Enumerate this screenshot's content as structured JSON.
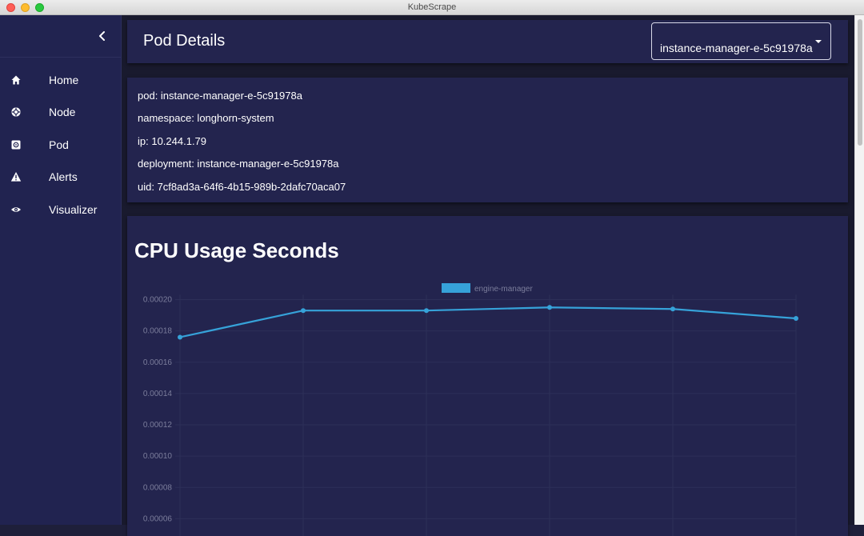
{
  "window": {
    "title": "KubeScrape"
  },
  "sidebar": {
    "items": [
      {
        "label": "Home",
        "icon": "home-icon"
      },
      {
        "label": "Node",
        "icon": "node-icon"
      },
      {
        "label": "Pod",
        "icon": "pod-icon"
      },
      {
        "label": "Alerts",
        "icon": "alert-icon"
      },
      {
        "label": "Visualizer",
        "icon": "eye-icon"
      }
    ]
  },
  "header": {
    "title": "Pod Details",
    "pod_select": {
      "selected": "instance-manager-e-5c91978a"
    }
  },
  "pod_info": {
    "pod": "pod: instance-manager-e-5c91978a",
    "namespace": "namespace: longhorn-system",
    "ip": "ip: 10.244.1.79",
    "deployment": "deployment: instance-manager-e-5c91978a",
    "uid": "uid: 7cf8ad3a-64f6-4b15-989b-2dafc70aca07"
  },
  "chart_section": {
    "title": "CPU Usage Seconds"
  },
  "colors": {
    "sidebar_bg": "#212350",
    "card_bg": "#23244e",
    "app_bg": "#191a2e",
    "series": "#36a2d9",
    "tick_text": "#7b7d9b"
  },
  "chart_data": {
    "type": "line",
    "title": "",
    "xlabel": "",
    "ylabel": "",
    "x": [
      1,
      2,
      3,
      4,
      5,
      6
    ],
    "series": [
      {
        "name": "engine-manager",
        "values": [
          0.000176,
          0.000193,
          0.000193,
          0.000195,
          0.000194,
          0.000188
        ]
      }
    ],
    "y_ticks": [
      "0.00020",
      "0.00018",
      "0.00016",
      "0.00014",
      "0.00012",
      "0.00010",
      "0.00008",
      "0.00006"
    ],
    "ylim": [
      6e-05,
      0.0002
    ],
    "legend_position": "top",
    "grid": true
  }
}
